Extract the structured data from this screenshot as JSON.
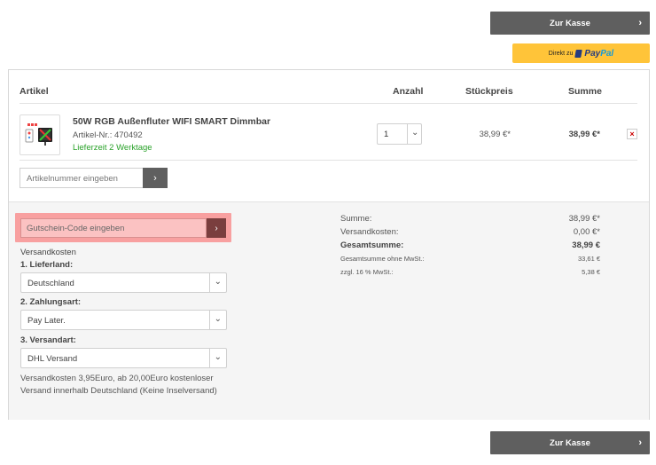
{
  "checkout_top_label": "Zur Kasse",
  "checkout_bottom_label": "Zur Kasse",
  "paypal": {
    "prefix": "Direkt zu",
    "brand_a": "Pay",
    "brand_b": "Pal"
  },
  "table": {
    "headers": {
      "article": "Artikel",
      "quantity": "Anzahl",
      "unit_price": "Stückpreis",
      "total": "Summe"
    },
    "item": {
      "title": "50W RGB Außenfluter WIFI SMART Dimmbar",
      "article_no": "Artikel-Nr.: 470492",
      "delivery": "Lieferzeit 2 Werktage",
      "quantity": "1",
      "unit_price": "38,99 €*",
      "total": "38,99 €*"
    }
  },
  "article_input": {
    "placeholder": "Artikelnummer eingeben"
  },
  "coupon_input": {
    "placeholder": "Gutschein-Code eingeben"
  },
  "shipping": {
    "title": "Versandkosten",
    "country_label": "1. Lieferland:",
    "country_value": "Deutschland",
    "payment_label": "2. Zahlungsart:",
    "payment_value": "Pay Later.",
    "method_label": "3. Versandart:",
    "method_value": "DHL Versand",
    "info": "Versandkosten 3,95Euro, ab 20,00Euro kostenloser Versand innerhalb Deutschland (Keine Inselversand)"
  },
  "totals": {
    "sum_label": "Summe:",
    "sum_value": "38,99 €*",
    "shipping_label": "Versandkosten:",
    "shipping_value": "0,00 €*",
    "grand_label": "Gesamtsumme:",
    "grand_value": "38,99 €",
    "net_label": "Gesamtsumme ohne MwSt.:",
    "net_value": "33,61 €",
    "vat_label": "zzgl. 16 % MwSt.:",
    "vat_value": "5,38 €"
  },
  "icons": {
    "chevron": "›",
    "chevron_down": "⌄",
    "remove": "×"
  },
  "colors": {
    "button_dark": "#5f5f5f",
    "paypal_yellow": "#ffc439",
    "delivery_green": "#2aa22a",
    "highlight": "#f8a0a0"
  }
}
